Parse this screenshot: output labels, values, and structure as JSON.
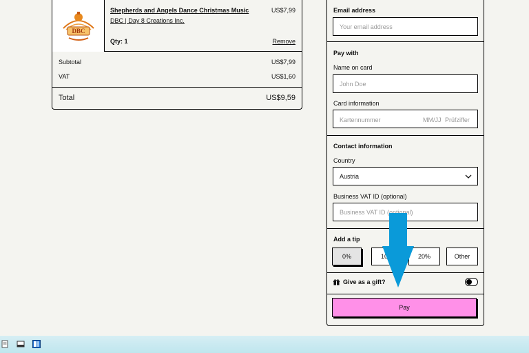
{
  "cart": {
    "item": {
      "title": "Shepherds and Angels Dance Christmas Music",
      "seller": "DBC | Day 8 Creations Inc.",
      "price": "US$7,99",
      "qty": "Qty: 1",
      "remove_label": "Remove",
      "logo_text": "DBC"
    },
    "subtotal_label": "Subtotal",
    "subtotal_value": "US$7,99",
    "vat_label": "VAT",
    "vat_value": "US$1,60",
    "total_label": "Total",
    "total_value": "US$9,59"
  },
  "checkout": {
    "email": {
      "label": "Email address",
      "placeholder": "Your email address"
    },
    "pay_with_label": "Pay with",
    "name_on_card": {
      "label": "Name on card",
      "placeholder": "John Doe"
    },
    "card_info": {
      "label": "Card information",
      "number_placeholder": "Kartennummer",
      "expiry_placeholder": "MM/JJ",
      "cvc_placeholder": "Prüfziffer"
    },
    "contact_label": "Contact information",
    "country": {
      "label": "Country",
      "value": "Austria"
    },
    "vat_id": {
      "label": "Business VAT ID (optional)",
      "placeholder": "Business VAT ID (optional)"
    },
    "tip": {
      "label": "Add a tip",
      "options": [
        "0%",
        "10%",
        "20%",
        "Other"
      ],
      "selected": "0%"
    },
    "gift_label": "Give as a gift?",
    "pay_label": "Pay"
  },
  "colors": {
    "pay_button": "#ff90e8",
    "arrow": "#0a9ad9",
    "background": "#f4f4f0"
  }
}
